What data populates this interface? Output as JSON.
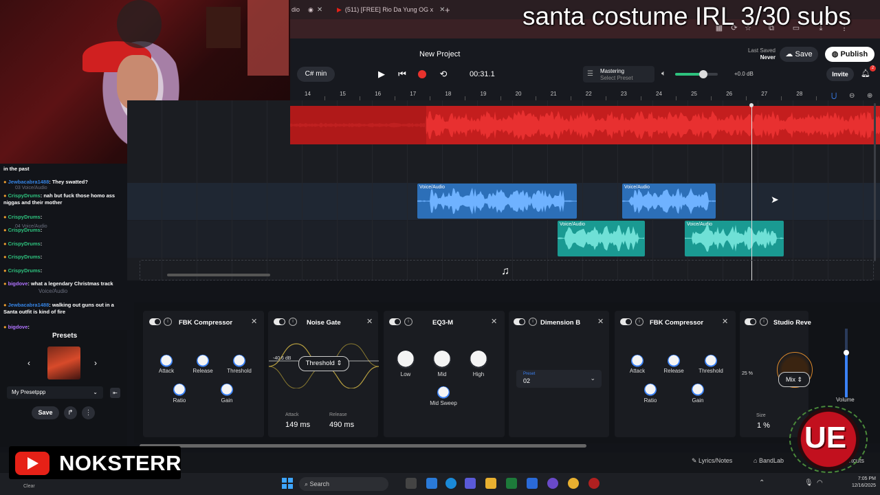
{
  "stream_overlay": {
    "title": "santa costume IRL 3/30 subs",
    "channel_name": "NOKSTERR",
    "logo_text": "UE"
  },
  "browser": {
    "tabs": [
      {
        "label": "dio",
        "icon": "tab-fragment"
      },
      {
        "label": "",
        "icon": "record-icon"
      },
      {
        "label": "(511) [FREE] Rio Da Yung OG x",
        "icon": "youtube-icon"
      }
    ],
    "new_tab": "+"
  },
  "header": {
    "project_title": "New Project",
    "last_saved_label": "Last Saved",
    "last_saved_value": "Never",
    "save_label": "Save",
    "publish_label": "Publish",
    "invite_label": "Invite",
    "notifications_count": "2"
  },
  "transport": {
    "key": "C# min",
    "timecode": "00:31.1",
    "mastering_label": "Mastering",
    "mastering_preset": "Select Preset",
    "volume_db": "+0.0 dB",
    "master_volume_fraction": 0.7
  },
  "ruler": {
    "bars": [
      "14",
      "15",
      "16",
      "17",
      "18",
      "19",
      "20",
      "21",
      "22",
      "23",
      "24",
      "25",
      "26",
      "27",
      "28"
    ]
  },
  "tracks": {
    "clips": [
      {
        "label": "Voice/Audio"
      },
      {
        "label": "Voice/Audio"
      },
      {
        "label": "Voice/Audio"
      },
      {
        "label": "Voice/Audio"
      }
    ]
  },
  "effects": [
    {
      "name": "FBK Compressor",
      "knobs": [
        "Attack",
        "Release",
        "Threshold",
        "Ratio",
        "Gain"
      ]
    },
    {
      "name": "Noise Gate",
      "threshold_label": "Threshold",
      "threshold_db": "-40.6 dB",
      "attack_label": "Attack",
      "attack_value": "149 ms",
      "release_label": "Release",
      "release_value": "490 ms"
    },
    {
      "name": "EQ3-M",
      "knobs": [
        "Low",
        "Mid",
        "High",
        "Mid Sweep"
      ]
    },
    {
      "name": "Dimension B",
      "preset_label": "Preset",
      "preset_value": "02"
    },
    {
      "name": "FBK Compressor",
      "knobs": [
        "Attack",
        "Release",
        "Threshold",
        "Ratio",
        "Gain"
      ]
    },
    {
      "name": "Studio Reve",
      "mix_label": "Mix",
      "mix_value": "25 %",
      "size_label": "Size",
      "size_value": "1 %"
    }
  ],
  "volume_fader_label": "Volume",
  "presets": {
    "title": "Presets",
    "selected": "My Presetppp",
    "save_label": "Save"
  },
  "bottom_bar": {
    "lyrics_label": "Lyrics/Notes",
    "bandlab_label": "BandLab",
    "shortcuts_label": "ortcuts"
  },
  "taskbar": {
    "search_placeholder": "Search",
    "time": "7:05 PM",
    "date": "12/16/2025",
    "weather_label": "Clear"
  },
  "chat": [
    {
      "user": "",
      "text": "in the past",
      "user_color": "green"
    },
    {
      "user": "Jewbacabra1488",
      "text": ": They swatted?",
      "user_color": "blue"
    },
    {
      "user": "CrispyDrums",
      "text": ": nah but fuck those homo ass niggas and their mother",
      "user_color": "green"
    },
    {
      "user": "CrispyDrums",
      "text": ":",
      "user_color": "green"
    },
    {
      "user": "CrispyDrums",
      "text": ":",
      "user_color": "green"
    },
    {
      "user": "CrispyDrums",
      "text": ":",
      "user_color": "green"
    },
    {
      "user": "CrispyDrums",
      "text": ":",
      "user_color": "green"
    },
    {
      "user": "CrispyDrums",
      "text": ":",
      "user_color": "green"
    },
    {
      "user": "bigdove",
      "text": ": what a legendary Christmas track",
      "user_color": "purple"
    },
    {
      "user": "Jewbacabra1488",
      "text": ": walking out guns out in a Santa outfit is kind of fire",
      "user_color": "blue"
    },
    {
      "user": "bigdove",
      "text": ":",
      "user_color": "purple"
    }
  ],
  "ghost_tracks": [
    "03 Voice/Audio",
    "04 Voice/Audio",
    "Voice/Audio"
  ],
  "colors": {
    "accent": "#3b82f6",
    "record": "#e8322d",
    "master_clip": "#c41e1e",
    "voice_clip_blue": "#2c6fb8",
    "voice_clip_teal": "#1a9a92"
  }
}
